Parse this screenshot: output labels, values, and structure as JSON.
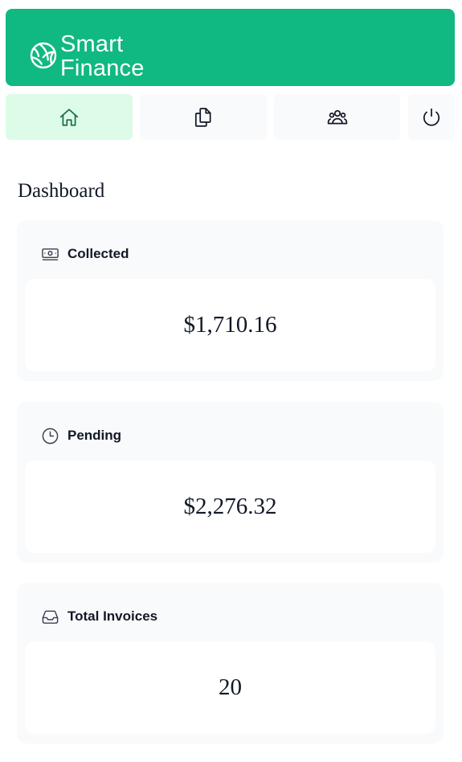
{
  "brand": {
    "line1": "Smart",
    "line2": "Finance",
    "icon": "globe-icon",
    "color": "#10b981"
  },
  "nav": [
    {
      "icon": "home-icon",
      "active": true
    },
    {
      "icon": "documents-icon",
      "active": false
    },
    {
      "icon": "users-icon",
      "active": false
    },
    {
      "icon": "power-icon",
      "active": false
    }
  ],
  "colors": {
    "active_nav_bg": "#dcfce7",
    "nav_bg": "#f9fafb",
    "card_bg": "#f9fafb"
  },
  "page": {
    "title": "Dashboard"
  },
  "cards": [
    {
      "label": "Collected",
      "value": "$1,710.16",
      "icon": "banknotes-icon"
    },
    {
      "label": "Pending",
      "value": "$2,276.32",
      "icon": "clock-icon"
    },
    {
      "label": "Total Invoices",
      "value": "20",
      "icon": "inbox-icon"
    }
  ]
}
